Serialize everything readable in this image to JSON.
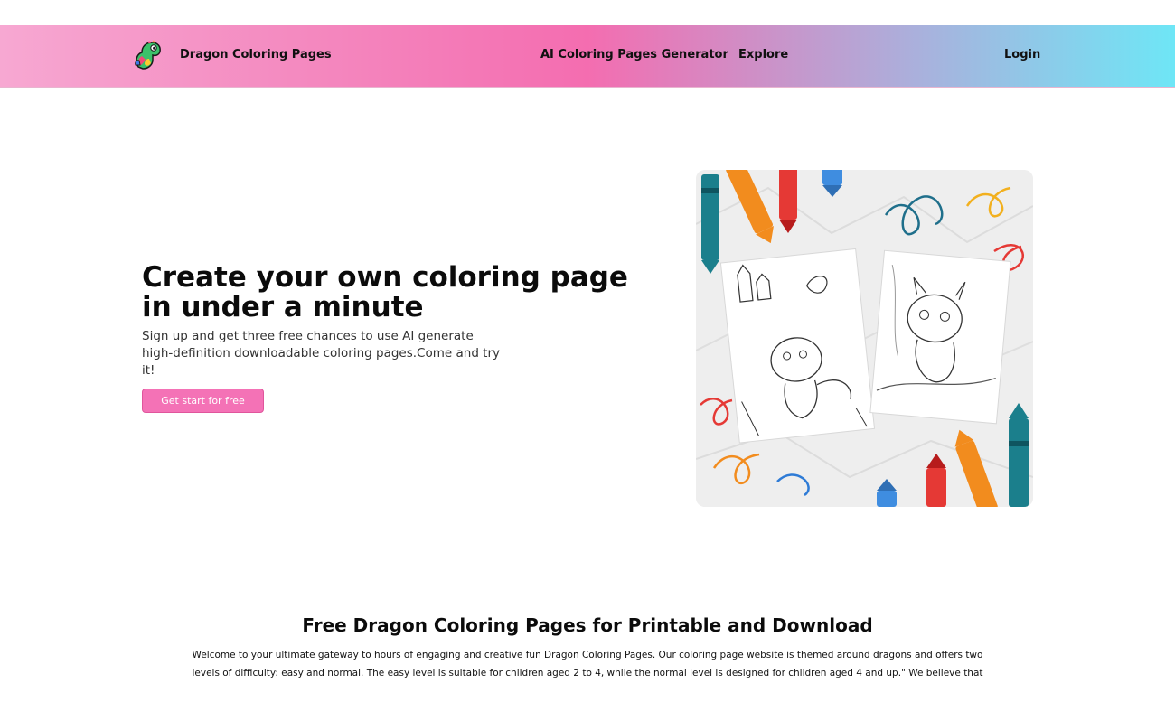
{
  "header": {
    "brand": "Dragon Coloring Pages",
    "nav": {
      "generator": "AI Coloring Pages Generator",
      "explore": "Explore",
      "login": "Login"
    },
    "gradient_colors": [
      "#f7a8d2",
      "#f46db0",
      "#6ee6f6"
    ]
  },
  "hero": {
    "title": "Create your own coloring page in under a minute",
    "subtitle": "Sign up and get three free chances to use AI generate high-definition downloadable coloring pages.Come and try it!",
    "cta_label": "Get start for free",
    "accent_color": "#f472b6"
  },
  "section": {
    "title": "Free Dragon Coloring Pages for Printable and Download",
    "text": "Welcome to your ultimate gateway to hours of engaging and creative fun Dragon Coloring Pages. Our coloring page website is themed around dragons and offers two levels of difficulty: easy and normal. The easy level is suitable for children aged 2 to 4, while the normal level is designed for children aged 4 and up.\" We believe that"
  },
  "icons": {
    "logo": "dragon-logo-icon",
    "hero_image": "crayons-dragon-coloring-pages-illustration"
  }
}
